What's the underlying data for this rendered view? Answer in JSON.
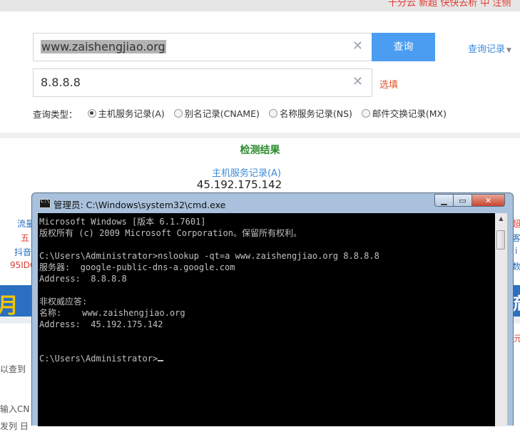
{
  "top_banner": {
    "text": "十分云 新超 快快去析 中 注侧"
  },
  "search": {
    "domain_value": "www.zaishengjiao.org",
    "dns_value": "8.8.8.8",
    "clear_icon": "close-icon",
    "query_label": "查询",
    "history_label": "查询记录",
    "fill_label": "选填",
    "type_label": "查询类型：",
    "options": [
      {
        "label": "主机服务记录(A)",
        "selected": true
      },
      {
        "label": "别名记录(CNAME)",
        "selected": false
      },
      {
        "label": "名称服务记录(NS)",
        "selected": false
      },
      {
        "label": "邮件交换记录(MX)",
        "selected": false
      }
    ]
  },
  "result": {
    "title": "检测结果",
    "type": "主机服务记录(A)",
    "ip": "45.192.175.142"
  },
  "background": {
    "left": [
      "流量",
      "五",
      "抖音",
      "95IDC"
    ],
    "right": [
      "超",
      "客",
      "i",
      "数"
    ],
    "left_band": "月半",
    "right_band": "流",
    "left_lower": [
      "以查到",
      "输入CN",
      "发列 日"
    ],
    "right_lower": "元"
  },
  "cmd": {
    "title": "管理员: C:\\Windows\\system32\\cmd.exe",
    "lines": [
      "Microsoft Windows [版本 6.1.7601]",
      "版权所有 (c) 2009 Microsoft Corporation。保留所有权利。",
      "",
      "C:\\Users\\Administrator>nslookup -qt=a www.zaishengjiao.org 8.8.8.8",
      "服务器:  google-public-dns-a.google.com",
      "Address:  8.8.8.8",
      "",
      "非权威应答:",
      "名称:    www.zaishengjiao.org",
      "Address:  45.192.175.142",
      "",
      "",
      "C:\\Users\\Administrator>"
    ]
  }
}
